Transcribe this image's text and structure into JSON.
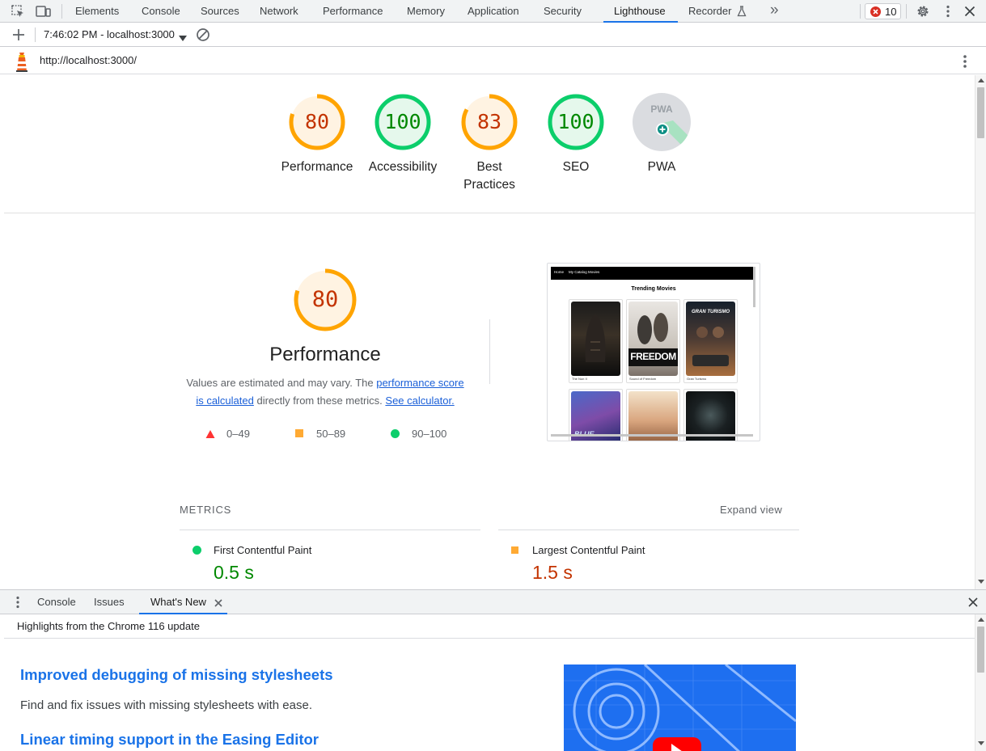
{
  "devtools": {
    "tabs": [
      "Elements",
      "Console",
      "Sources",
      "Network",
      "Performance",
      "Memory",
      "Application",
      "Security",
      "Lighthouse",
      "Recorder"
    ],
    "active_tab": "Lighthouse",
    "more_tabs_glyph": "»",
    "error_count": "10",
    "icons": [
      "inspect-element-icon",
      "device-toolbar-icon",
      "recorder-flask-icon",
      "error-x-icon",
      "gear-icon",
      "kebab-menu-icon",
      "close-icon"
    ]
  },
  "toolbar": {
    "report_selector": "7:46:02 PM - localhost:3000",
    "icons": [
      "plus-icon",
      "dropdown-caret-icon",
      "clear-block-icon"
    ]
  },
  "url_bar": {
    "url": "http://localhost:3000/",
    "icons": [
      "lighthouse-logo-icon",
      "kebab-menu-icon"
    ]
  },
  "score_summary": [
    {
      "label": "Performance",
      "score": "80",
      "status": "average"
    },
    {
      "label": "Accessibility",
      "score": "100",
      "status": "pass"
    },
    {
      "label_line1": "Best",
      "label_line2": "Practices",
      "score": "83",
      "status": "average"
    },
    {
      "label": "SEO",
      "score": "100",
      "status": "pass"
    },
    {
      "label": "PWA",
      "badge_text": "PWA",
      "status": "pwa"
    }
  ],
  "performance_section": {
    "score": "80",
    "title": "Performance",
    "description_pre": "Values are estimated and may vary. The ",
    "link1_line1": "performance score",
    "link1_line2": "is calculated",
    "description_mid": " directly from these metrics. ",
    "link2": "See calculator.",
    "legend": [
      {
        "range": "0–49",
        "shape": "triangle",
        "color": "#ff3333"
      },
      {
        "range": "50–89",
        "shape": "square",
        "color": "#ffaa33"
      },
      {
        "range": "90–100",
        "shape": "circle",
        "color": "#0cce6b"
      }
    ]
  },
  "screenshot_thumb": {
    "nav_links": [
      "Home",
      "My Catalog Movies"
    ],
    "heading": "Trending Movies",
    "movies": [
      "The Nun II",
      "Sound of Freedom",
      "Gran Turismo",
      "",
      "",
      ""
    ],
    "poster_text": [
      "",
      "FREEDOM",
      "GRAN TURISMO",
      "BLUE",
      "",
      ""
    ]
  },
  "metrics": {
    "heading": "METRICS",
    "expand_label": "Expand view",
    "items": [
      {
        "name": "First Contentful Paint",
        "value": "0.5 s",
        "status": "pass"
      },
      {
        "name": "Largest Contentful Paint",
        "value": "1.5 s",
        "status": "average"
      }
    ]
  },
  "drawer": {
    "tabs": [
      "Console",
      "Issues",
      "What's New"
    ],
    "active_tab": "What's New",
    "header": "Highlights from the Chrome 116 update",
    "items": [
      {
        "title": "Improved debugging of missing stylesheets",
        "description": "Find and fix issues with missing stylesheets with ease."
      },
      {
        "title": "Linear timing support in the Easing Editor",
        "description": ""
      }
    ]
  },
  "colors": {
    "pass": "#0cce6b",
    "pass_text": "#008800",
    "average": "#ffa400",
    "average_text": "#c33300",
    "fail": "#ff3333",
    "accent": "#1a73e8"
  }
}
